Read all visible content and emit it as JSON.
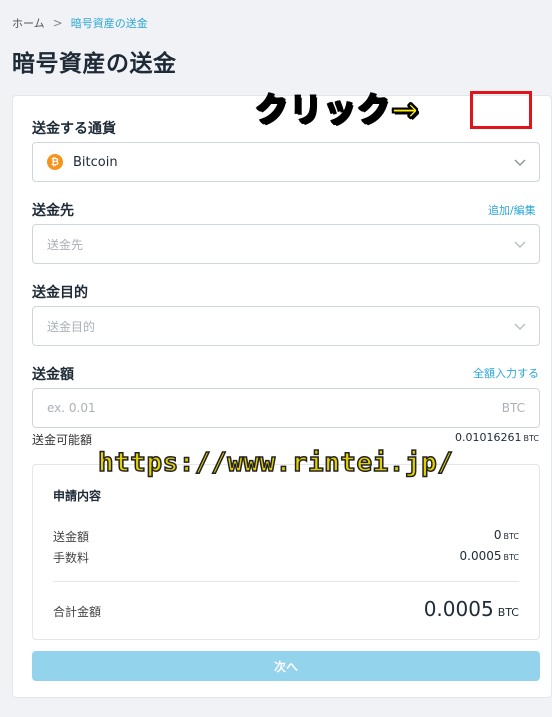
{
  "breadcrumb": {
    "home": "ホーム",
    "separator": ">",
    "current": "暗号資産の送金"
  },
  "page_title": "暗号資産の送金",
  "currency": {
    "label": "送金する通貨",
    "selected": "Bitcoin",
    "icon": "bitcoin-icon"
  },
  "destination": {
    "label": "送金先",
    "placeholder": "送金先",
    "add_edit_link": "追加/編集"
  },
  "purpose": {
    "label": "送金目的",
    "placeholder": "送金目的"
  },
  "amount": {
    "label": "送金額",
    "enter_all_link": "全額入力する",
    "placeholder": "ex. 0.01",
    "unit": "BTC",
    "available_label": "送金可能額",
    "available_value": "0.01016261",
    "available_unit": "BTC"
  },
  "annotation": {
    "click_text": "クリック→",
    "watermark": "https://www.rintei.jp/"
  },
  "summary": {
    "title": "申請内容",
    "rows": [
      {
        "label": "送金額",
        "value": "0",
        "unit": "BTC"
      },
      {
        "label": "手数料",
        "value": "0.0005",
        "unit": "BTC"
      }
    ],
    "total_label": "合計金額",
    "total_value": "0.0005",
    "total_unit": "BTC"
  },
  "next_button": "次へ",
  "colors": {
    "accent": "#2aa6d6",
    "button": "#93d4ec",
    "annotation_box": "#e0141b",
    "annotation_text": "#ffee00"
  }
}
